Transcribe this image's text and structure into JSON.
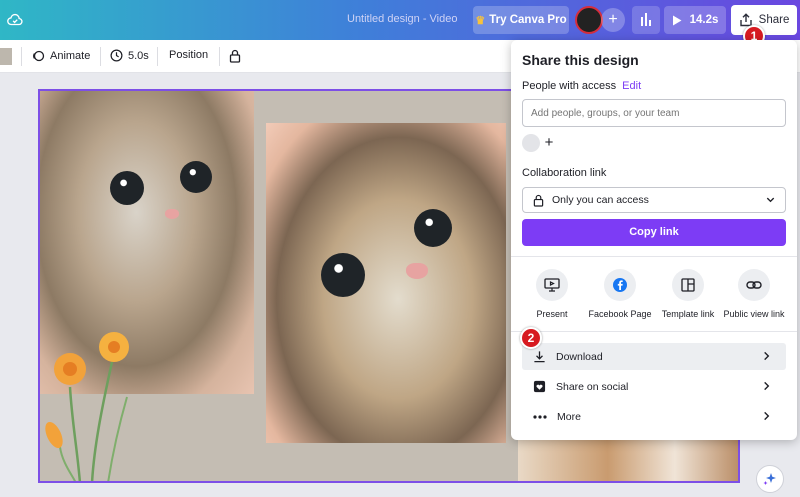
{
  "topbar": {
    "doc_title": "Untitled design - Video",
    "try_pro_label": "Try Canva Pro",
    "play_duration": "14.2s",
    "share_label": "Share",
    "step_badge_1": "1"
  },
  "toolbar": {
    "animate_label": "Animate",
    "duration_label": "5.0s",
    "position_label": "Position"
  },
  "share_panel": {
    "title": "Share this design",
    "people_label": "People with access",
    "edit_label": "Edit",
    "people_placeholder": "Add people, groups, or your team",
    "collab_label": "Collaboration link",
    "access_value": "Only you can access",
    "copy_link_label": "Copy link",
    "options": [
      {
        "label": "Present",
        "icon": "present-icon"
      },
      {
        "label": "Facebook Page",
        "icon": "facebook-icon"
      },
      {
        "label": "Template link",
        "icon": "template-icon"
      },
      {
        "label": "Public view link",
        "icon": "link-icon"
      }
    ],
    "step_badge_2": "2",
    "rows": [
      {
        "label": "Download",
        "icon": "download-icon"
      },
      {
        "label": "Share on social",
        "icon": "heart-icon"
      },
      {
        "label": "More",
        "icon": "more-icon"
      }
    ]
  },
  "colors": {
    "accent": "#7d3cf5",
    "badge": "#d71a20"
  }
}
